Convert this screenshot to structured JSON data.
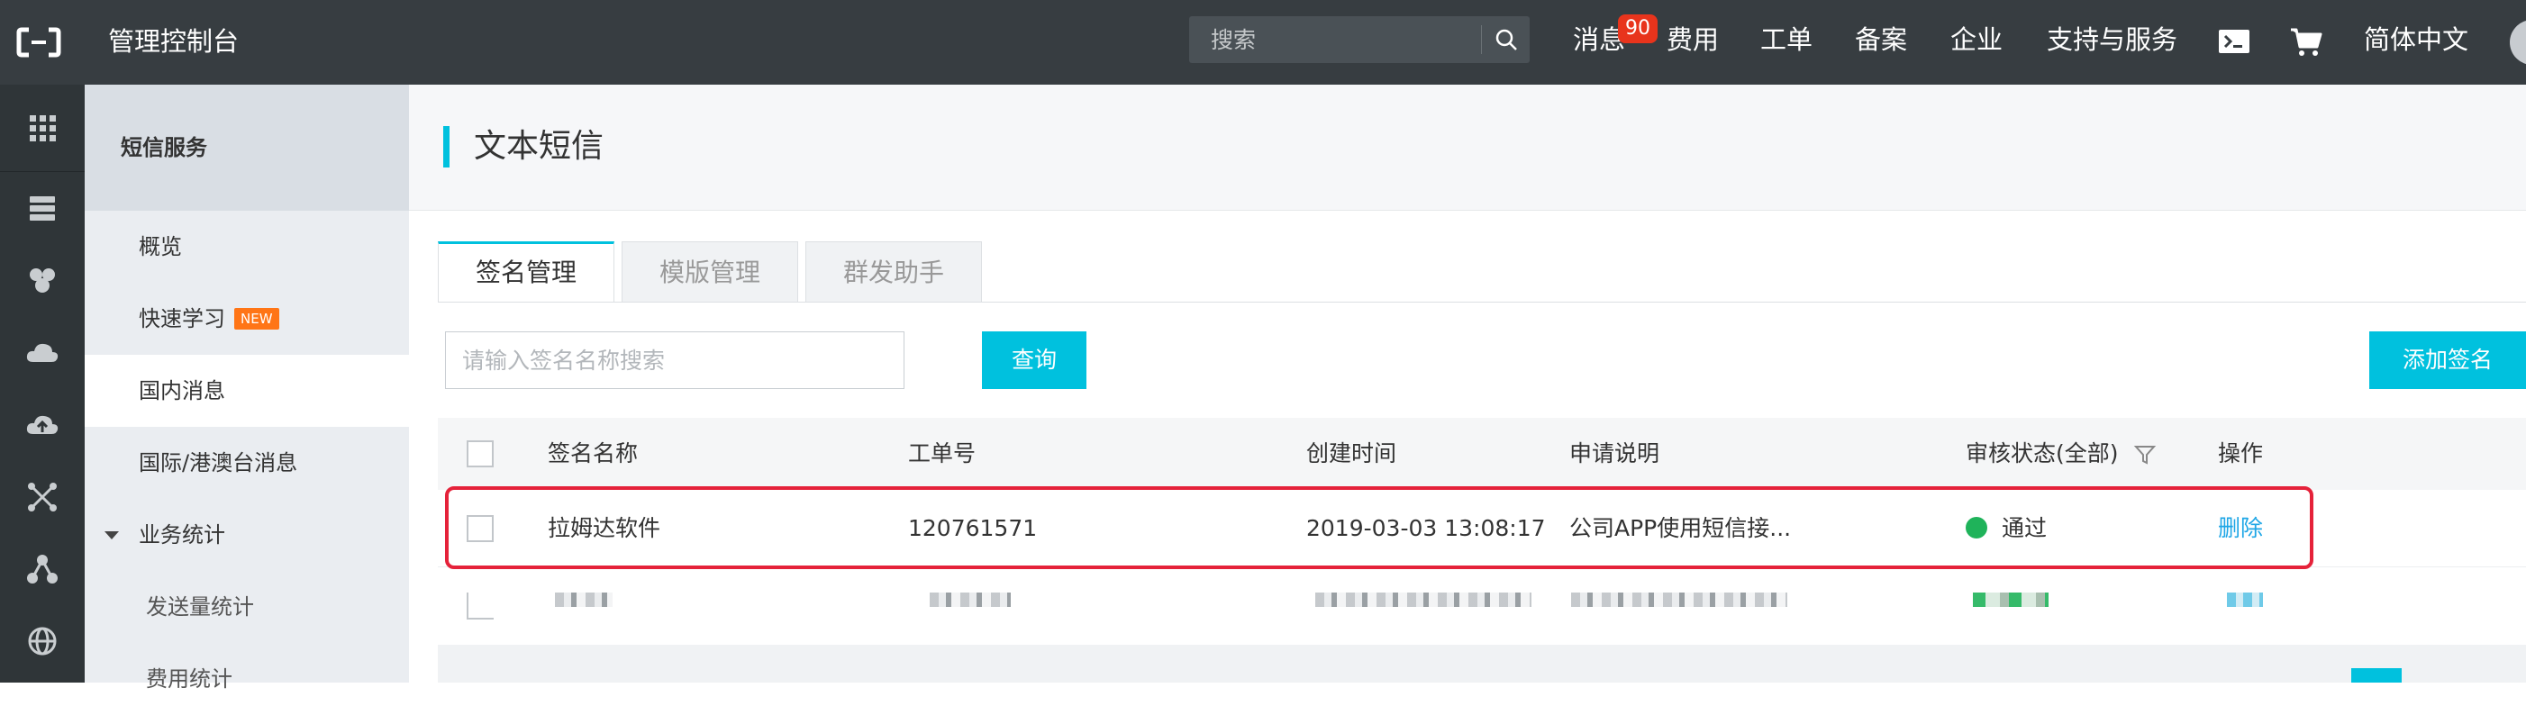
{
  "topbar": {
    "title": "管理控制台",
    "search_placeholder": "搜索",
    "nav": {
      "messages": "消息",
      "messages_count": "90",
      "fees": "费用",
      "tickets": "工单",
      "icp": "备案",
      "enterprise": "企业",
      "support": "支持与服务",
      "language": "简体中文"
    }
  },
  "sidebar": {
    "header": "短信服务",
    "items": [
      {
        "label": "概览"
      },
      {
        "label": "快速学习",
        "badge": "NEW"
      },
      {
        "label": "国内消息"
      },
      {
        "label": "国际/港澳台消息"
      },
      {
        "label": "业务统计"
      },
      {
        "label": "发送量统计"
      },
      {
        "label": "费用统计"
      }
    ]
  },
  "main": {
    "title": "文本短信",
    "tabs": [
      {
        "label": "签名管理"
      },
      {
        "label": "模版管理"
      },
      {
        "label": "群发助手"
      }
    ],
    "search_placeholder": "请输入签名名称搜索",
    "query_label": "查询",
    "add_label": "添加签名",
    "table": {
      "headers": {
        "name": "签名名称",
        "ticket": "工单号",
        "created": "创建时间",
        "desc": "申请说明",
        "status": "审核状态(全部)",
        "actions": "操作"
      },
      "rows": [
        {
          "name": "拉姆达软件",
          "ticket": "120761571",
          "created": "2019-03-03 13:08:17",
          "desc": "公司APP使用短信接...",
          "status": "通过",
          "action": "删除"
        }
      ]
    }
  },
  "colors": {
    "accent": "#00c1de",
    "topbar": "#373d41",
    "badge": "#e8341c",
    "highlight": "#e5223a",
    "status_ok": "#1fb35a"
  }
}
